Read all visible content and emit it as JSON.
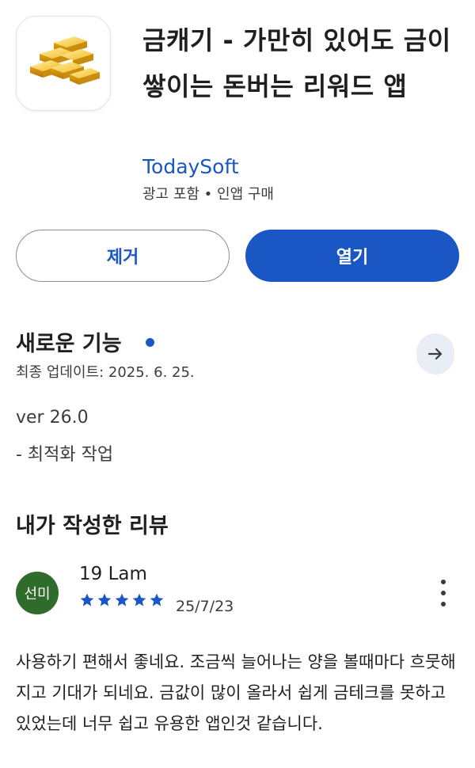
{
  "app": {
    "title": "금캐기 - 가만히 있어도 금이 쌓이는 돈버는 리워드 앱",
    "developer": "TodaySoft",
    "meta": "광고 포함 • 인앱 구매",
    "icon": "gold-bars-icon"
  },
  "actions": {
    "remove_label": "제거",
    "open_label": "열기"
  },
  "whats_new": {
    "title": "새로운 기능",
    "last_updated": "최종 업데이트: 2025. 6. 25.",
    "version": "ver 26.0",
    "notes": "- 최적화 작업"
  },
  "my_review": {
    "section_title": "내가 작성한 리뷰",
    "avatar_text": "선미",
    "reviewer_name": "19 Lam",
    "rating": 5,
    "max_rating": 5,
    "date": "25/7/23",
    "text": "사용하기 편해서 좋네요. 조금씩 늘어나는 양을 볼때마다 흐뭇해지고 기대가 되네요. 금값이 많이 올라서 쉽게 금테크를 못하고 있었는데 너무 쉽고 유용한 앱인것 같습니다."
  },
  "colors": {
    "accent": "#1a56c4",
    "avatar_bg": "#2f6b2a",
    "arrow_bg": "#e9eef6"
  }
}
